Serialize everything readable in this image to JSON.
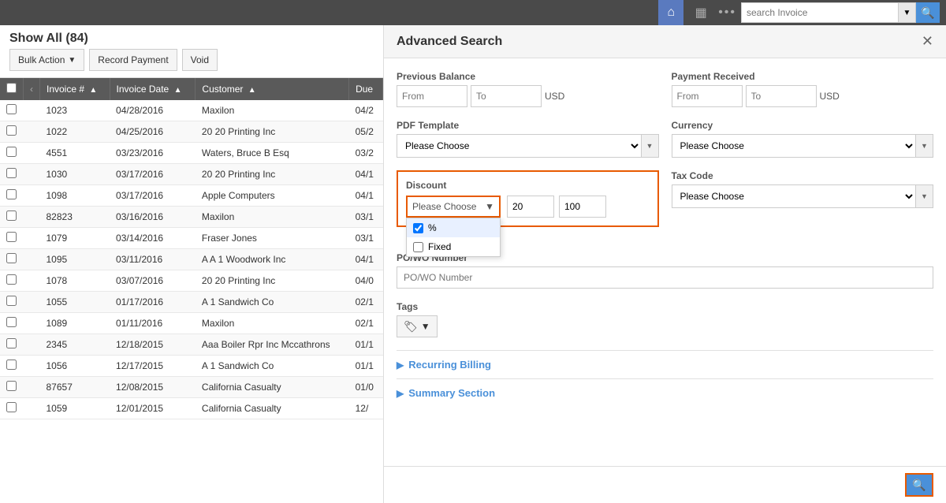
{
  "topNav": {
    "searchPlaceholder": "search Invoice",
    "homeIcon": "⌂",
    "chartIcon": "▦",
    "dotsIcon": "•••",
    "dropdownArrow": "▼",
    "searchIcon": "🔍"
  },
  "leftPanel": {
    "title": "Show All (84)",
    "buttons": {
      "bulkAction": "Bulk Action",
      "recordPayment": "Record Payment",
      "void": "Void"
    },
    "table": {
      "columns": [
        "",
        "",
        "Invoice #",
        "Invoice Date",
        "Customer",
        "Due"
      ],
      "rows": [
        {
          "invoice": "1023",
          "date": "04/28/2016",
          "customer": "Maxilon",
          "due": "04/2"
        },
        {
          "invoice": "1022",
          "date": "04/25/2016",
          "customer": "20 20 Printing Inc",
          "due": "05/2"
        },
        {
          "invoice": "4551",
          "date": "03/23/2016",
          "customer": "Waters, Bruce B Esq",
          "due": "03/2"
        },
        {
          "invoice": "1030",
          "date": "03/17/2016",
          "customer": "20 20 Printing Inc",
          "due": "04/1"
        },
        {
          "invoice": "1098",
          "date": "03/17/2016",
          "customer": "Apple Computers",
          "due": "04/1"
        },
        {
          "invoice": "82823",
          "date": "03/16/2016",
          "customer": "Maxilon",
          "due": "03/1"
        },
        {
          "invoice": "1079",
          "date": "03/14/2016",
          "customer": "Fraser Jones",
          "due": "03/1"
        },
        {
          "invoice": "1095",
          "date": "03/11/2016",
          "customer": "A A 1 Woodwork Inc",
          "due": "04/1"
        },
        {
          "invoice": "1078",
          "date": "03/07/2016",
          "customer": "20 20 Printing Inc",
          "due": "04/0"
        },
        {
          "invoice": "1055",
          "date": "01/17/2016",
          "customer": "A 1 Sandwich Co",
          "due": "02/1"
        },
        {
          "invoice": "1089",
          "date": "01/11/2016",
          "customer": "Maxilon",
          "due": "02/1"
        },
        {
          "invoice": "2345",
          "date": "12/18/2015",
          "customer": "Aaa Boiler Rpr Inc Mccathrons",
          "due": "01/1"
        },
        {
          "invoice": "1056",
          "date": "12/17/2015",
          "customer": "A 1 Sandwich Co",
          "due": "01/1"
        },
        {
          "invoice": "87657",
          "date": "12/08/2015",
          "customer": "California Casualty",
          "due": "01/0"
        },
        {
          "invoice": "1059",
          "date": "12/01/2015",
          "customer": "California Casualty",
          "due": "12/"
        }
      ]
    }
  },
  "advancedSearch": {
    "title": "Advanced Search",
    "sections": {
      "previousBalance": {
        "label": "Previous Balance",
        "fromPlaceholder": "From",
        "toPlaceholder": "To",
        "currency": "USD"
      },
      "paymentReceived": {
        "label": "Payment Received",
        "fromPlaceholder": "From",
        "toPlaceholder": "To",
        "currency": "USD"
      },
      "pdfTemplate": {
        "label": "PDF Template",
        "placeholder": "Please Choose"
      },
      "currency": {
        "label": "Currency",
        "placeholder": "Please Choose"
      },
      "discount": {
        "label": "Discount",
        "selectPlaceholder": "Please Choose",
        "value1": "20",
        "value2": "100",
        "dropdownItems": [
          {
            "label": "%",
            "checked": true
          },
          {
            "label": "Fixed",
            "checked": false
          }
        ]
      },
      "taxCode": {
        "label": "Tax Code",
        "placeholder": "Please Choose"
      },
      "powoNumber": {
        "label": "PO/WO Number",
        "placeholder": "PO/WO Number"
      },
      "tags": {
        "label": "Tags",
        "buttonIcon": "🏷",
        "buttonCaret": "▼"
      }
    },
    "collapsible": {
      "recurringBilling": "Recurring Billing",
      "summarySection": "Summary Section"
    },
    "footer": {
      "searchIcon": "🔍"
    }
  }
}
